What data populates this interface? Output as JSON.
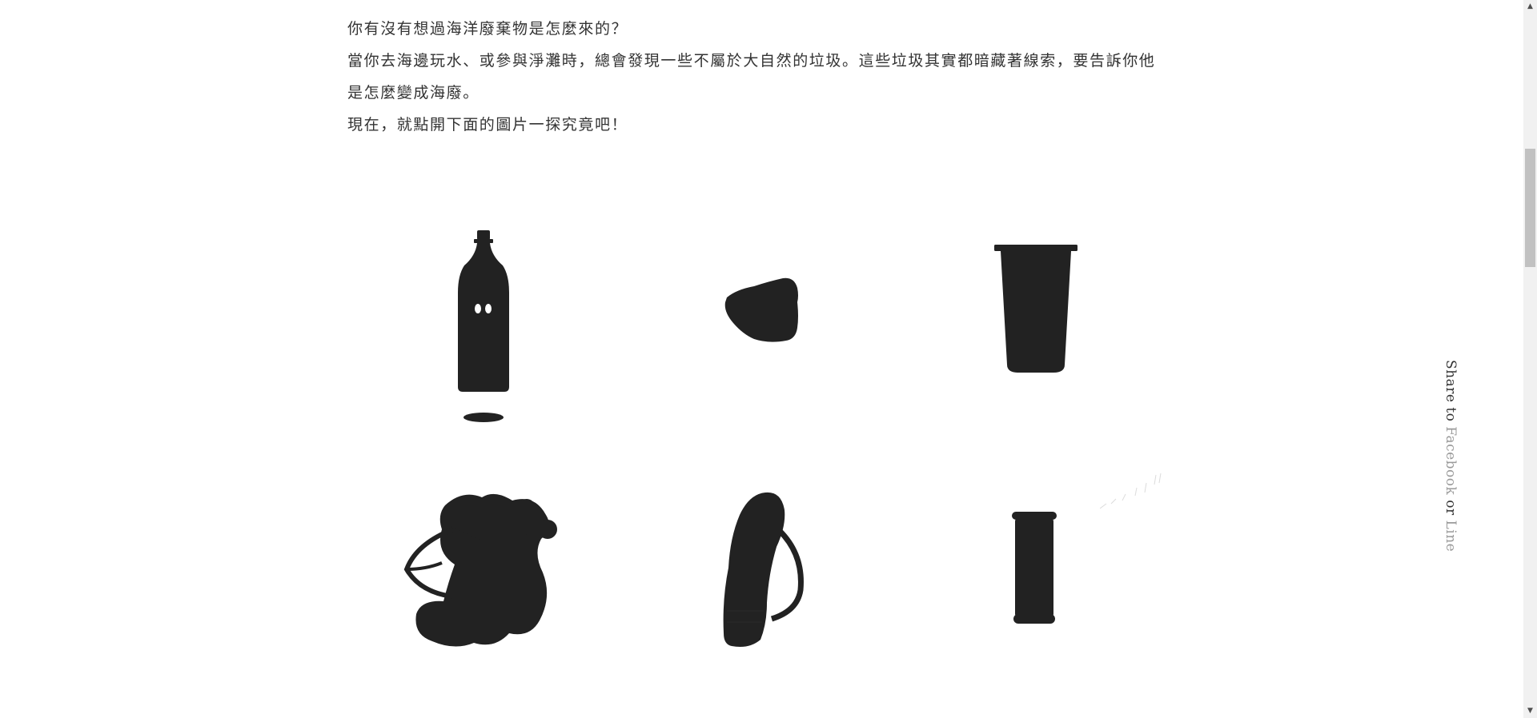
{
  "intro": {
    "line1": "你有沒有想過海洋廢棄物是怎麼來的？",
    "line2": "當你去海邊玩水、或參與淨灘時，總會發現一些不屬於大自然的垃圾。這些垃圾其實都暗藏著線索，要告訴你他是怎麼變成海廢。",
    "line3": "現在，就點開下面的圖片一探究竟吧！"
  },
  "items": [
    {
      "icon": "plastic-bottle"
    },
    {
      "icon": "styrofoam-piece"
    },
    {
      "icon": "drink-cup"
    },
    {
      "icon": "fishing-net-bundle"
    },
    {
      "icon": "food-wrapper"
    },
    {
      "icon": "can"
    }
  ],
  "share": {
    "prefix": "Share to ",
    "facebook": "Facebook",
    "or": " or ",
    "line": "Line"
  },
  "scrollbar": {
    "up": "▲",
    "down": "▼"
  },
  "colors": {
    "text": "#333333",
    "silhouette": "#222222",
    "share_link": "#9a9a9a"
  }
}
